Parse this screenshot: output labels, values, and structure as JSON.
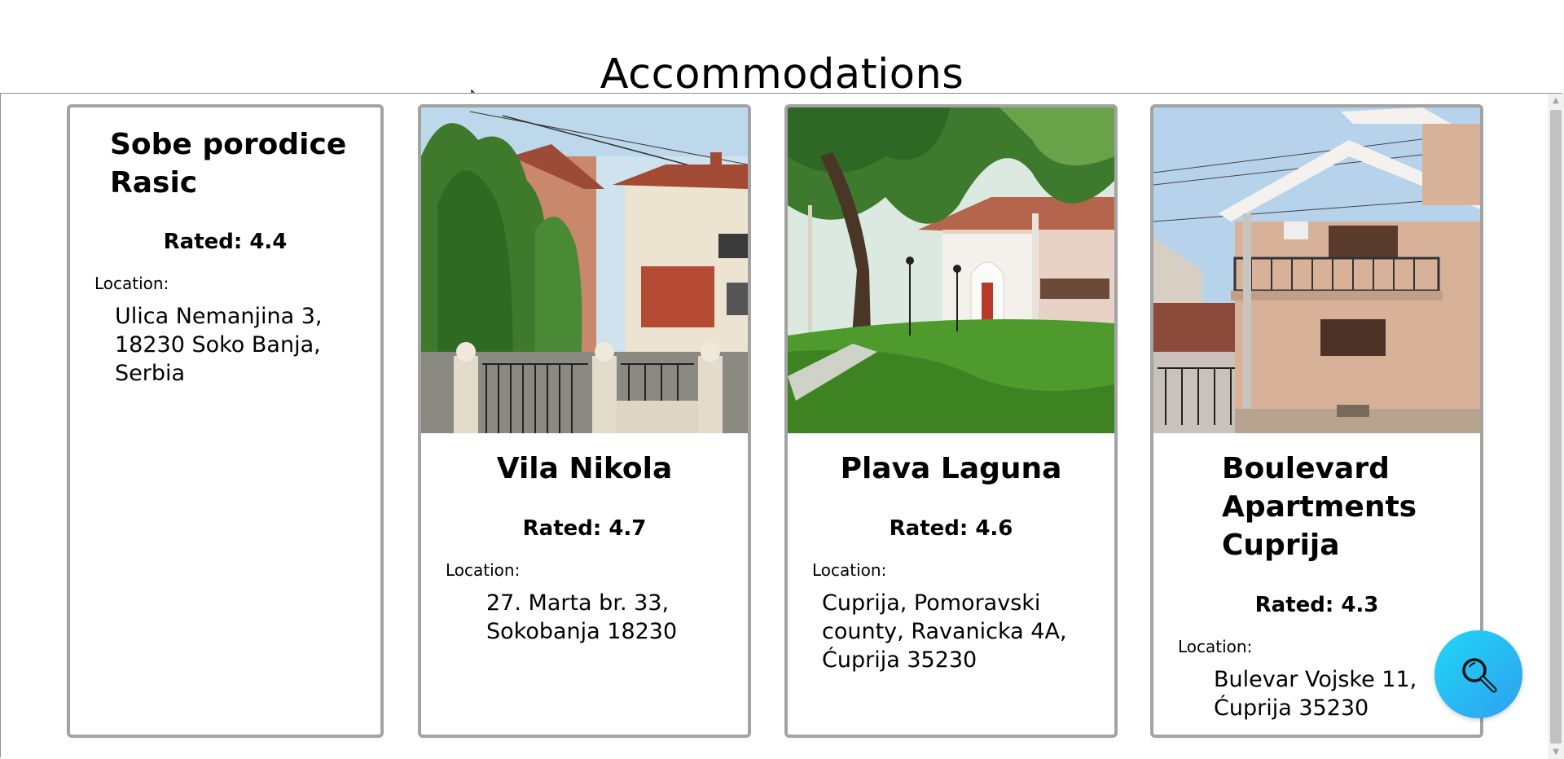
{
  "page": {
    "title": "Accommodations"
  },
  "accommodations": [
    {
      "name": "Sobe porodice Rasic",
      "rating": "Rated: 4.4",
      "location_label": "Location:",
      "address": "Ulica Nemanjina 3, 18230 Soko Banja, Serbia",
      "has_photo": false
    },
    {
      "name": "Vila Nikola",
      "rating": "Rated: 4.7",
      "location_label": "Location:",
      "address": "27. Marta br. 33, Sokobanja 18230",
      "has_photo": true,
      "photo": "house-with-cypress-hedge-photo"
    },
    {
      "name": "Plava Laguna",
      "rating": "Rated: 4.6",
      "location_label": "Location:",
      "address": "Cuprija, Pomoravski county, Ravanicka 4A, Ćuprija 35230",
      "has_photo": true,
      "photo": "white-villa-garden-photo"
    },
    {
      "name": "Boulevard Apartments Cuprija",
      "rating": "Rated: 4.3",
      "location_label": "Location:",
      "address": "Bulevar Vojske 11, Ćuprija 35230",
      "has_photo": true,
      "photo": "apartment-building-balcony-photo"
    }
  ],
  "search_button": {
    "icon": "magnifier-icon"
  },
  "colors": {
    "card_border": "#a3a3a3",
    "fab_gradient_start": "#1fd7f4",
    "fab_gradient_end": "#2f9ff2"
  }
}
